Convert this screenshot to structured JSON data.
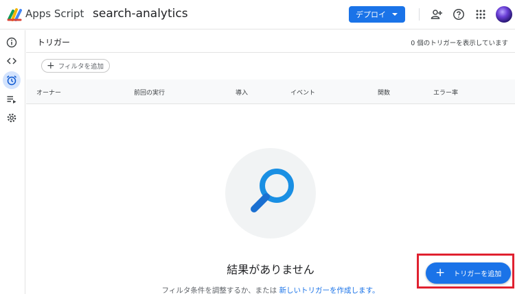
{
  "header": {
    "app_name": "Apps Script",
    "project_name": "search-analytics",
    "deploy_label": "デプロイ",
    "icons": [
      "add-user-icon",
      "help-icon",
      "apps-grid-icon",
      "avatar"
    ]
  },
  "sidebar": {
    "items": [
      {
        "name": "overview",
        "icon": "info-icon"
      },
      {
        "name": "editor",
        "icon": "code-icon"
      },
      {
        "name": "triggers",
        "icon": "alarm-clock-icon",
        "active": true
      },
      {
        "name": "executions",
        "icon": "list-run-icon"
      },
      {
        "name": "settings",
        "icon": "gear-icon"
      }
    ]
  },
  "main": {
    "title": "トリガー",
    "count_text": "0 個のトリガーを表示しています",
    "filter_label": "フィルタを追加",
    "columns": [
      "オーナー",
      "前回の実行",
      "導入",
      "イベント",
      "関数",
      "エラー率"
    ],
    "empty_title": "結果がありません",
    "empty_sub_prefix": "フィルタ条件を調整するか、または",
    "empty_sub_link": "新しいトリガーを作成します",
    "empty_sub_suffix": "。"
  },
  "fab": {
    "label": "トリガーを追加"
  },
  "colors": {
    "accent": "#1a73e8",
    "highlight_frame": "#e0202f",
    "active_nav_bg": "#d3e3fd"
  }
}
